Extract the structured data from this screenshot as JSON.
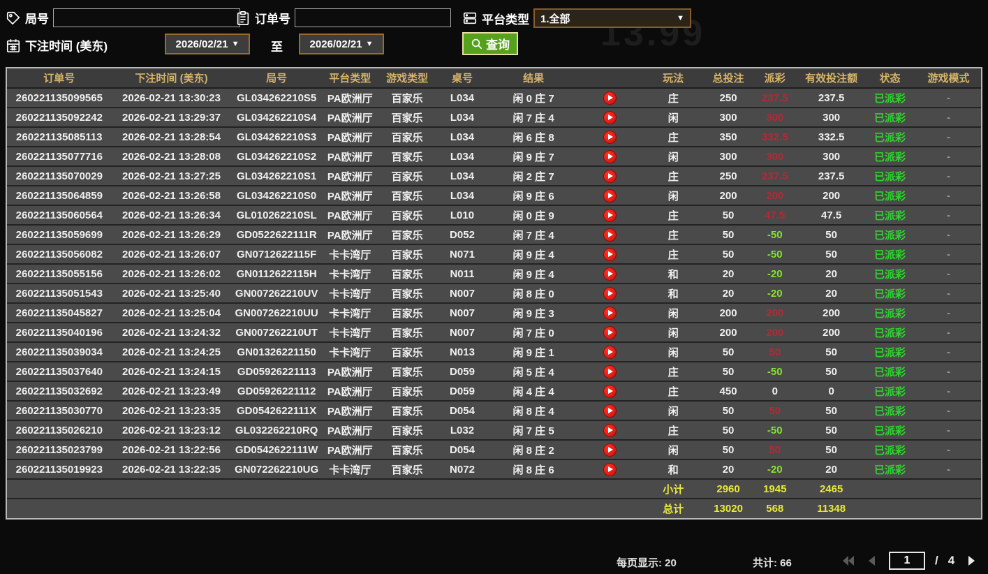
{
  "background": {
    "watermark": "13.99"
  },
  "filters": {
    "round_label": "局号",
    "round_value": "",
    "order_label": "订单号",
    "order_value": "",
    "platform_label": "平台类型",
    "platform_value": "1.全部",
    "time_label": "下注时间 (美东)",
    "date_from": "2026/02/21",
    "to_label": "至",
    "date_to": "2026/02/21",
    "search_label": "查询"
  },
  "icons": {
    "dropdown_arrow": "▼"
  },
  "table": {
    "columns": [
      "订单号",
      "下注时间 (美东)",
      "局号",
      "平台类型",
      "游戏类型",
      "桌号",
      "结果",
      "",
      "玩法",
      "总投注",
      "派彩",
      "有效投注额",
      "状态",
      "游戏模式"
    ],
    "rows": [
      {
        "order": "260221135099565",
        "time": "2026-02-21 13:30:23",
        "round": "GL034262210S5",
        "platform": "PA欧洲厅",
        "game_type": "百家乐",
        "table_no": "L034",
        "result": "闲 0 庄 7",
        "play_type": "庄",
        "total_bet": "250",
        "payout": "237.5",
        "valid_bet": "237.5",
        "status": "已派彩",
        "mode": "-"
      },
      {
        "order": "260221135092242",
        "time": "2026-02-21 13:29:37",
        "round": "GL034262210S4",
        "platform": "PA欧洲厅",
        "game_type": "百家乐",
        "table_no": "L034",
        "result": "闲 7 庄 4",
        "play_type": "闲",
        "total_bet": "300",
        "payout": "300",
        "valid_bet": "300",
        "status": "已派彩",
        "mode": "-"
      },
      {
        "order": "260221135085113",
        "time": "2026-02-21 13:28:54",
        "round": "GL034262210S3",
        "platform": "PA欧洲厅",
        "game_type": "百家乐",
        "table_no": "L034",
        "result": "闲 6 庄 8",
        "play_type": "庄",
        "total_bet": "350",
        "payout": "332.5",
        "valid_bet": "332.5",
        "status": "已派彩",
        "mode": "-"
      },
      {
        "order": "260221135077716",
        "time": "2026-02-21 13:28:08",
        "round": "GL034262210S2",
        "platform": "PA欧洲厅",
        "game_type": "百家乐",
        "table_no": "L034",
        "result": "闲 9 庄 7",
        "play_type": "闲",
        "total_bet": "300",
        "payout": "300",
        "valid_bet": "300",
        "status": "已派彩",
        "mode": "-"
      },
      {
        "order": "260221135070029",
        "time": "2026-02-21 13:27:25",
        "round": "GL034262210S1",
        "platform": "PA欧洲厅",
        "game_type": "百家乐",
        "table_no": "L034",
        "result": "闲 2 庄 7",
        "play_type": "庄",
        "total_bet": "250",
        "payout": "237.5",
        "valid_bet": "237.5",
        "status": "已派彩",
        "mode": "-"
      },
      {
        "order": "260221135064859",
        "time": "2026-02-21 13:26:58",
        "round": "GL034262210S0",
        "platform": "PA欧洲厅",
        "game_type": "百家乐",
        "table_no": "L034",
        "result": "闲 9 庄 6",
        "play_type": "闲",
        "total_bet": "200",
        "payout": "200",
        "valid_bet": "200",
        "status": "已派彩",
        "mode": "-"
      },
      {
        "order": "260221135060564",
        "time": "2026-02-21 13:26:34",
        "round": "GL010262210SL",
        "platform": "PA欧洲厅",
        "game_type": "百家乐",
        "table_no": "L010",
        "result": "闲 0 庄 9",
        "play_type": "庄",
        "total_bet": "50",
        "payout": "47.5",
        "valid_bet": "47.5",
        "status": "已派彩",
        "mode": "-"
      },
      {
        "order": "260221135059699",
        "time": "2026-02-21 13:26:29",
        "round": "GD0522622111R",
        "platform": "PA欧洲厅",
        "game_type": "百家乐",
        "table_no": "D052",
        "result": "闲 7 庄 4",
        "play_type": "庄",
        "total_bet": "50",
        "payout": "-50",
        "valid_bet": "50",
        "status": "已派彩",
        "mode": "-"
      },
      {
        "order": "260221135056082",
        "time": "2026-02-21 13:26:07",
        "round": "GN0712622115F",
        "platform": "卡卡湾厅",
        "game_type": "百家乐",
        "table_no": "N071",
        "result": "闲 9 庄 4",
        "play_type": "庄",
        "total_bet": "50",
        "payout": "-50",
        "valid_bet": "50",
        "status": "已派彩",
        "mode": "-"
      },
      {
        "order": "260221135055156",
        "time": "2026-02-21 13:26:02",
        "round": "GN0112622115H",
        "platform": "卡卡湾厅",
        "game_type": "百家乐",
        "table_no": "N011",
        "result": "闲 9 庄 4",
        "play_type": "和",
        "total_bet": "20",
        "payout": "-20",
        "valid_bet": "20",
        "status": "已派彩",
        "mode": "-"
      },
      {
        "order": "260221135051543",
        "time": "2026-02-21 13:25:40",
        "round": "GN007262210UV",
        "platform": "卡卡湾厅",
        "game_type": "百家乐",
        "table_no": "N007",
        "result": "闲 8 庄 0",
        "play_type": "和",
        "total_bet": "20",
        "payout": "-20",
        "valid_bet": "20",
        "status": "已派彩",
        "mode": "-"
      },
      {
        "order": "260221135045827",
        "time": "2026-02-21 13:25:04",
        "round": "GN007262210UU",
        "platform": "卡卡湾厅",
        "game_type": "百家乐",
        "table_no": "N007",
        "result": "闲 9 庄 3",
        "play_type": "闲",
        "total_bet": "200",
        "payout": "200",
        "valid_bet": "200",
        "status": "已派彩",
        "mode": "-"
      },
      {
        "order": "260221135040196",
        "time": "2026-02-21 13:24:32",
        "round": "GN007262210UT",
        "platform": "卡卡湾厅",
        "game_type": "百家乐",
        "table_no": "N007",
        "result": "闲 7 庄 0",
        "play_type": "闲",
        "total_bet": "200",
        "payout": "200",
        "valid_bet": "200",
        "status": "已派彩",
        "mode": "-"
      },
      {
        "order": "260221135039034",
        "time": "2026-02-21 13:24:25",
        "round": "GN01326221150",
        "platform": "卡卡湾厅",
        "game_type": "百家乐",
        "table_no": "N013",
        "result": "闲 9 庄 1",
        "play_type": "闲",
        "total_bet": "50",
        "payout": "50",
        "valid_bet": "50",
        "status": "已派彩",
        "mode": "-"
      },
      {
        "order": "260221135037640",
        "time": "2026-02-21 13:24:15",
        "round": "GD05926221113",
        "platform": "PA欧洲厅",
        "game_type": "百家乐",
        "table_no": "D059",
        "result": "闲 5 庄 4",
        "play_type": "庄",
        "total_bet": "50",
        "payout": "-50",
        "valid_bet": "50",
        "status": "已派彩",
        "mode": "-"
      },
      {
        "order": "260221135032692",
        "time": "2026-02-21 13:23:49",
        "round": "GD05926221112",
        "platform": "PA欧洲厅",
        "game_type": "百家乐",
        "table_no": "D059",
        "result": "闲 4 庄 4",
        "play_type": "庄",
        "total_bet": "450",
        "payout": "0",
        "valid_bet": "0",
        "status": "已派彩",
        "mode": "-"
      },
      {
        "order": "260221135030770",
        "time": "2026-02-21 13:23:35",
        "round": "GD0542622111X",
        "platform": "PA欧洲厅",
        "game_type": "百家乐",
        "table_no": "D054",
        "result": "闲 8 庄 4",
        "play_type": "闲",
        "total_bet": "50",
        "payout": "50",
        "valid_bet": "50",
        "status": "已派彩",
        "mode": "-"
      },
      {
        "order": "260221135026210",
        "time": "2026-02-21 13:23:12",
        "round": "GL032262210RQ",
        "platform": "PA欧洲厅",
        "game_type": "百家乐",
        "table_no": "L032",
        "result": "闲 7 庄 5",
        "play_type": "庄",
        "total_bet": "50",
        "payout": "-50",
        "valid_bet": "50",
        "status": "已派彩",
        "mode": "-"
      },
      {
        "order": "260221135023799",
        "time": "2026-02-21 13:22:56",
        "round": "GD0542622111W",
        "platform": "PA欧洲厅",
        "game_type": "百家乐",
        "table_no": "D054",
        "result": "闲 8 庄 2",
        "play_type": "闲",
        "total_bet": "50",
        "payout": "50",
        "valid_bet": "50",
        "status": "已派彩",
        "mode": "-"
      },
      {
        "order": "260221135019923",
        "time": "2026-02-21 13:22:35",
        "round": "GN072262210UG",
        "platform": "卡卡湾厅",
        "game_type": "百家乐",
        "table_no": "N072",
        "result": "闲 8 庄 6",
        "play_type": "和",
        "total_bet": "20",
        "payout": "-20",
        "valid_bet": "20",
        "status": "已派彩",
        "mode": "-"
      }
    ],
    "subtotal": {
      "label": "小计",
      "total_bet": "2960",
      "payout": "1945",
      "valid_bet": "2465"
    },
    "total": {
      "label": "总计",
      "total_bet": "13020",
      "payout": "568",
      "valid_bet": "11348"
    }
  },
  "footer": {
    "per_page": "每页显示: 20",
    "total_count": "共计: 66",
    "page_value": "1",
    "page_sep": "/",
    "page_total": "4"
  },
  "colors": {
    "header_text": "#d6b469",
    "row_bg": "#4a4a4a",
    "payout_win": "#b22a35",
    "payout_loss": "#86e32d",
    "status_paid": "#2fd42f",
    "sum_text": "#e9e93b",
    "search_button_bg": "#55a11c",
    "date_border": "#9a6b2f"
  }
}
